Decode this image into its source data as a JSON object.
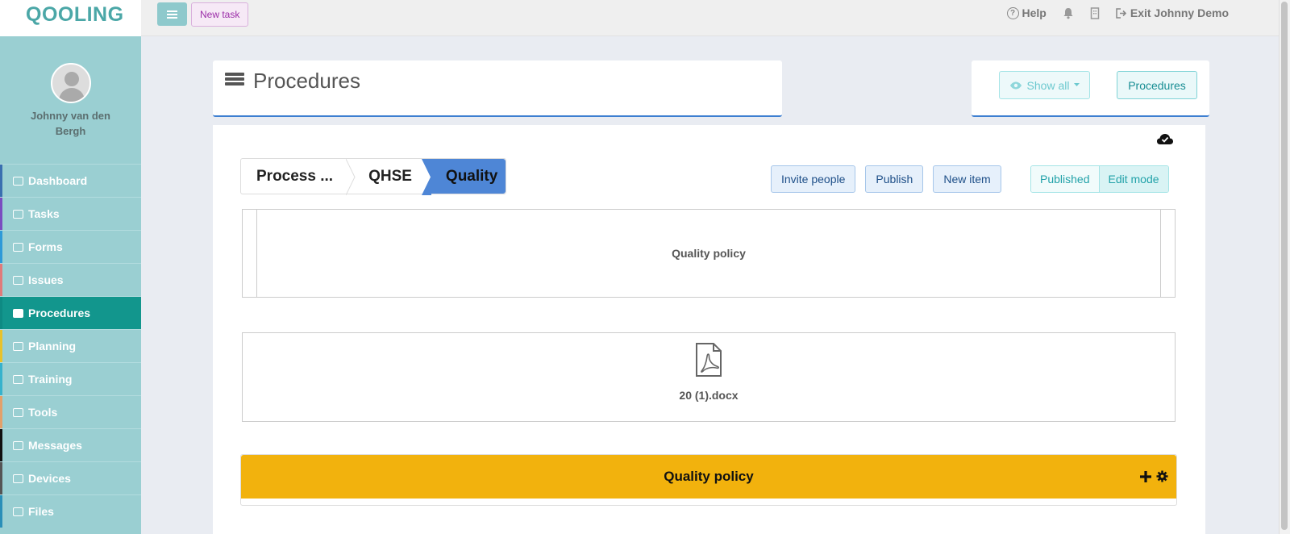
{
  "app": {
    "logo": "QOOLING",
    "new_task": "New task",
    "help": "Help",
    "exit": "Exit Johnny Demo"
  },
  "user": {
    "name": "Johnny van den Bergh"
  },
  "sidebar": {
    "items": [
      {
        "label": "Dashboard",
        "accent": "#3a6fb0"
      },
      {
        "label": "Tasks",
        "accent": "#7a4cc0"
      },
      {
        "label": "Forms",
        "accent": "#2e9ad8"
      },
      {
        "label": "Issues",
        "accent": "#e07a7a"
      },
      {
        "label": "Procedures",
        "accent": "#0e8a83"
      },
      {
        "label": "Planning",
        "accent": "#e8c22a"
      },
      {
        "label": "Training",
        "accent": "#36b2cc"
      },
      {
        "label": "Tools",
        "accent": "#e3a06a"
      },
      {
        "label": "Messages",
        "accent": "#111111"
      },
      {
        "label": "Devices",
        "accent": "#555555"
      },
      {
        "label": "Files",
        "accent": "#2a8fb8"
      }
    ],
    "active": "Procedures"
  },
  "header": {
    "title": "Procedures",
    "show_all": "Show all",
    "procedures_btn": "Procedures"
  },
  "breadcrumb": [
    "Process ...",
    "QHSE",
    "Quality"
  ],
  "actions": {
    "invite": "Invite people",
    "publish": "Publish",
    "new_item": "New item",
    "published": "Published",
    "edit_mode": "Edit mode"
  },
  "content": {
    "policy_title": "Quality policy",
    "document_name": "20 (1).docx",
    "section_title": "Quality policy"
  }
}
